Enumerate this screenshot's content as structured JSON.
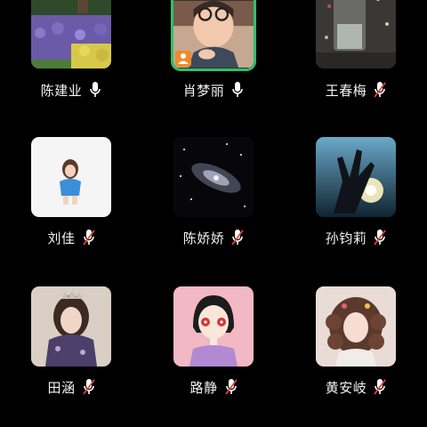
{
  "participants": [
    {
      "name": "陈建业",
      "mic": "mic-on-icon",
      "avatar": "flower-garden-photo"
    },
    {
      "name": "肖梦丽",
      "mic": "mic-on-icon",
      "avatar": "child-with-glasses-photo",
      "active_speaker": true,
      "host": true
    },
    {
      "name": "王春梅",
      "mic": "mic-muted-icon",
      "avatar": "glass-photo"
    },
    {
      "name": "刘佳",
      "mic": "mic-muted-icon",
      "avatar": "girl-illustration"
    },
    {
      "name": "陈娇娇",
      "mic": "mic-muted-icon",
      "avatar": "galaxy-photo"
    },
    {
      "name": "孙钧莉",
      "mic": "mic-muted-icon",
      "avatar": "hand-sunset-photo"
    },
    {
      "name": "田涵",
      "mic": "mic-muted-icon",
      "avatar": "woman-crown-photo"
    },
    {
      "name": "路静",
      "mic": "mic-muted-icon",
      "avatar": "girl-cartoon-illustration"
    },
    {
      "name": "黄安岐",
      "mic": "mic-muted-icon",
      "avatar": "curly-hair-girl-photo"
    }
  ],
  "colors": {
    "background": "#000000",
    "active_border": "#2fbf6b",
    "host_badge": "#ef8a2e",
    "name_text": "#f2f2f2"
  }
}
